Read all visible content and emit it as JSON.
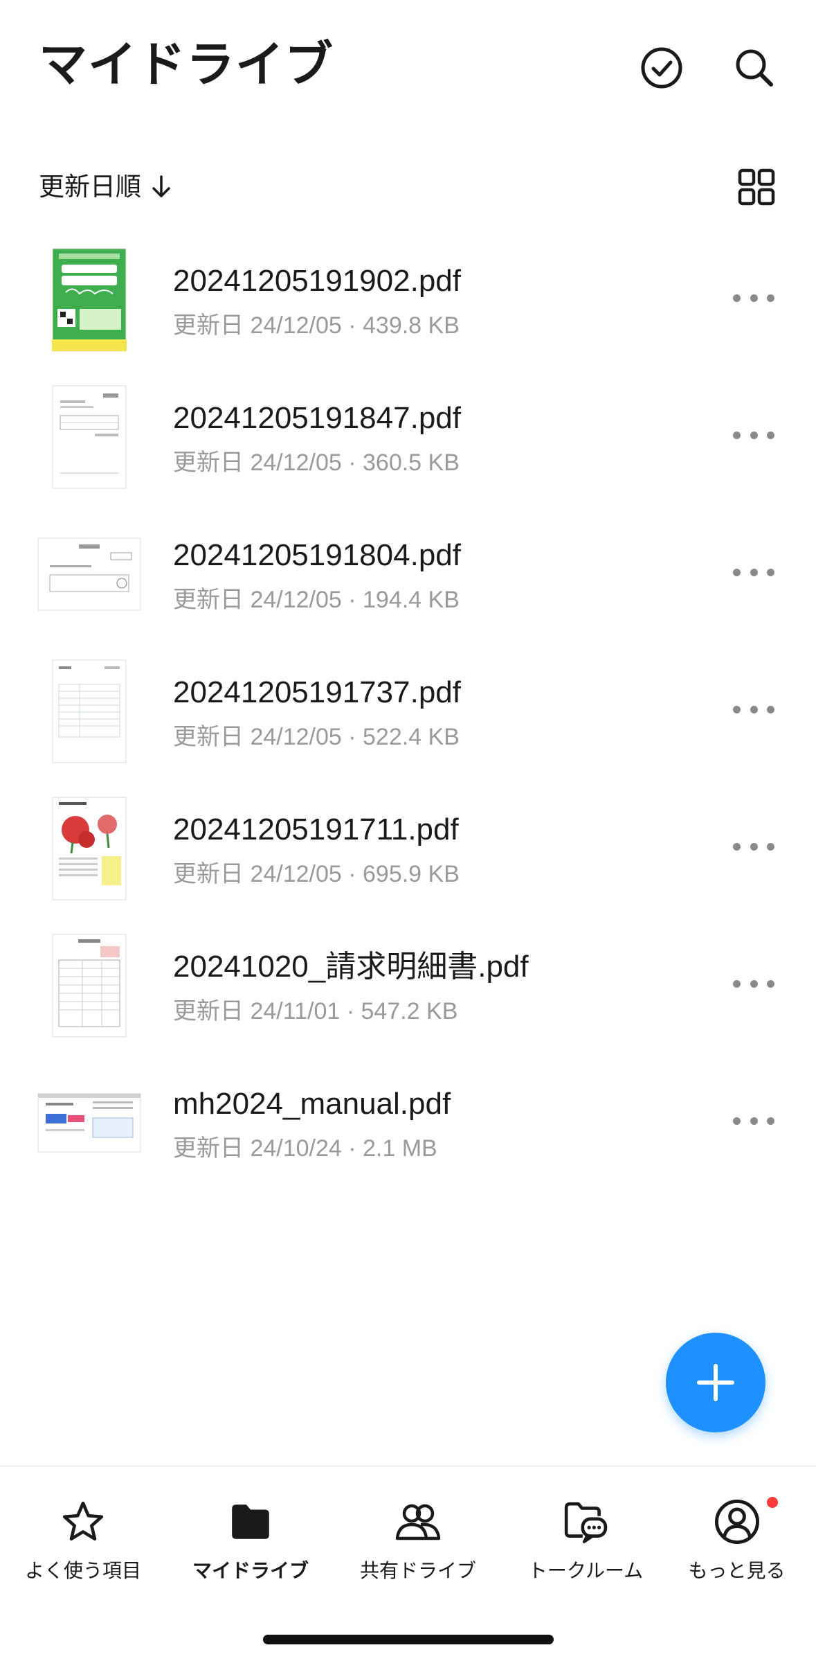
{
  "header": {
    "title": "マイドライブ",
    "select_icon": "check-circle-icon",
    "search_icon": "search-icon"
  },
  "sort": {
    "label": "更新日順",
    "direction_icon": "arrow-down-icon",
    "view_icon": "grid-view-icon"
  },
  "files": [
    {
      "name": "20241205191902.pdf",
      "meta": "更新日 24/12/05 · 439.8 KB",
      "thumb": "green-flyer"
    },
    {
      "name": "20241205191847.pdf",
      "meta": "更新日 24/12/05 · 360.5 KB",
      "thumb": "doc-portrait"
    },
    {
      "name": "20241205191804.pdf",
      "meta": "更新日 24/12/05 · 194.4 KB",
      "thumb": "doc-landscape"
    },
    {
      "name": "20241205191737.pdf",
      "meta": "更新日 24/12/05 · 522.4 KB",
      "thumb": "doc-table"
    },
    {
      "name": "20241205191711.pdf",
      "meta": "更新日 24/12/05 · 695.9 KB",
      "thumb": "flower-doc"
    },
    {
      "name": "20241020_請求明細書.pdf",
      "meta": "更新日 24/11/01 · 547.2 KB",
      "thumb": "invoice-doc"
    },
    {
      "name": "mh2024_manual.pdf",
      "meta": "更新日 24/10/24 · 2.1 MB",
      "thumb": "manual-landscape"
    }
  ],
  "fab": {
    "icon": "plus-icon"
  },
  "tabs": [
    {
      "label": "よく使う項目",
      "icon": "star-icon",
      "active": false
    },
    {
      "label": "マイドライブ",
      "icon": "folder-icon",
      "active": true
    },
    {
      "label": "共有ドライブ",
      "icon": "shared-users-icon",
      "active": false
    },
    {
      "label": "トークルーム",
      "icon": "chat-folder-icon",
      "active": false
    },
    {
      "label": "もっと見る",
      "icon": "account-icon",
      "active": false,
      "badge": true
    }
  ],
  "colors": {
    "accent": "#1e90ff",
    "badge": "#ff3b3b",
    "meta_text": "#9a9a9a"
  }
}
